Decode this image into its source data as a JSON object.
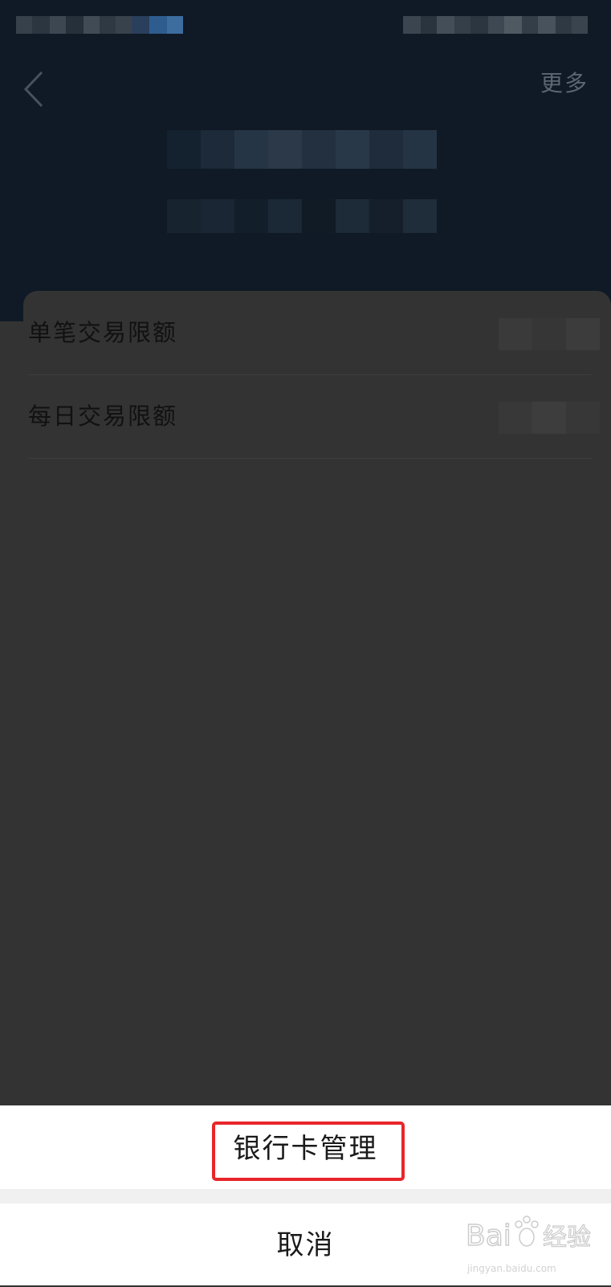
{
  "nav": {
    "more_label": "更多"
  },
  "limits": {
    "rows": [
      {
        "label": "单笔交易限额"
      },
      {
        "label": "每日交易限额"
      }
    ]
  },
  "action_sheet": {
    "option_label": "银行卡管理",
    "cancel_label": "取消"
  },
  "watermark": {
    "domain": "jingyan.baidu.com"
  },
  "colors": {
    "header_bg": "#0f1a26",
    "overlay_bg": "#333333",
    "highlight": "#e8262a",
    "sheet_bg": "#ffffff"
  },
  "icons": {
    "back": "chevron-left-icon"
  }
}
